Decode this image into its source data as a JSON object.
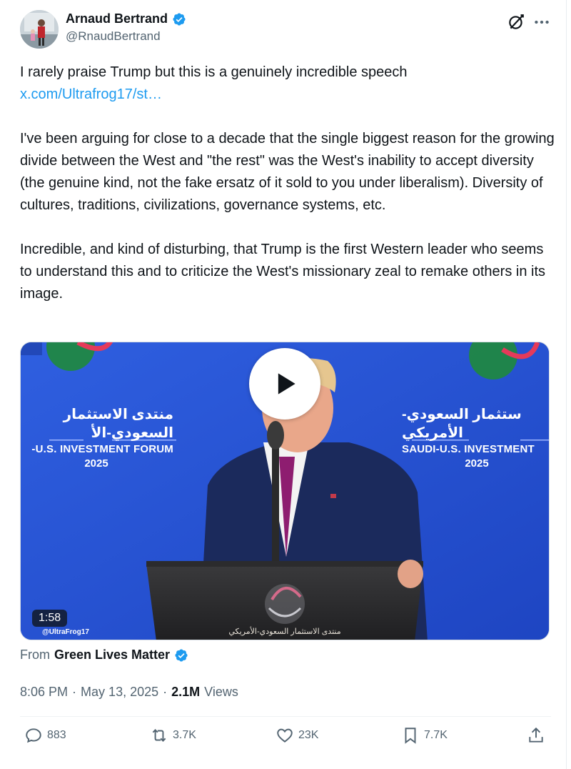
{
  "author": {
    "display_name": "Arnaud Bertrand",
    "handle": "@RnaudBertrand",
    "verified": true
  },
  "tweet": {
    "line1": "I rarely praise Trump but this is a genuinely incredible speech",
    "link_text": "x.com/Ultrafrog17/st…",
    "paragraph2": "I've been arguing for close to a decade that the single biggest reason for the growing divide between the West and \"the rest\" was the West's inability to accept diversity (the genuine kind, not the fake ersatz of it sold to you under liberalism). Diversity of cultures, traditions, civilizations, governance systems, etc.",
    "paragraph3": "Incredible, and kind of disturbing, that Trump is the first Western leader who seems to understand this and to criticize the West's missionary zeal to remake others in its image."
  },
  "video": {
    "duration": "1:58",
    "watermark": "@UltraFrog17",
    "banner_left": {
      "arabic": "منتدى الاستثمار السعودي-الأ",
      "english": "-U.S. INVESTMENT FORUM",
      "year": "2025"
    },
    "banner_right": {
      "arabic": "ستثمار السعودي-الأمريكي",
      "english": "SAUDI-U.S. INVESTMENT",
      "year": "2025"
    },
    "podium_text": "منتدى الاستثمار السعودي-الأمريكي"
  },
  "source": {
    "prefix": "From",
    "name": "Green Lives Matter"
  },
  "meta": {
    "time": "8:06 PM",
    "dot1": "·",
    "date": "May 13, 2025",
    "dot2": "·",
    "views_count": "2.1M",
    "views_label": "Views"
  },
  "actions": {
    "replies": "883",
    "reposts": "3.7K",
    "likes": "23K",
    "bookmarks": "7.7K"
  },
  "colors": {
    "link": "#1d9bf0",
    "verified": "#1d9bf0",
    "secondary_text": "#536471",
    "primary_text": "#0f1419",
    "video_bg": "#2a57d4"
  }
}
